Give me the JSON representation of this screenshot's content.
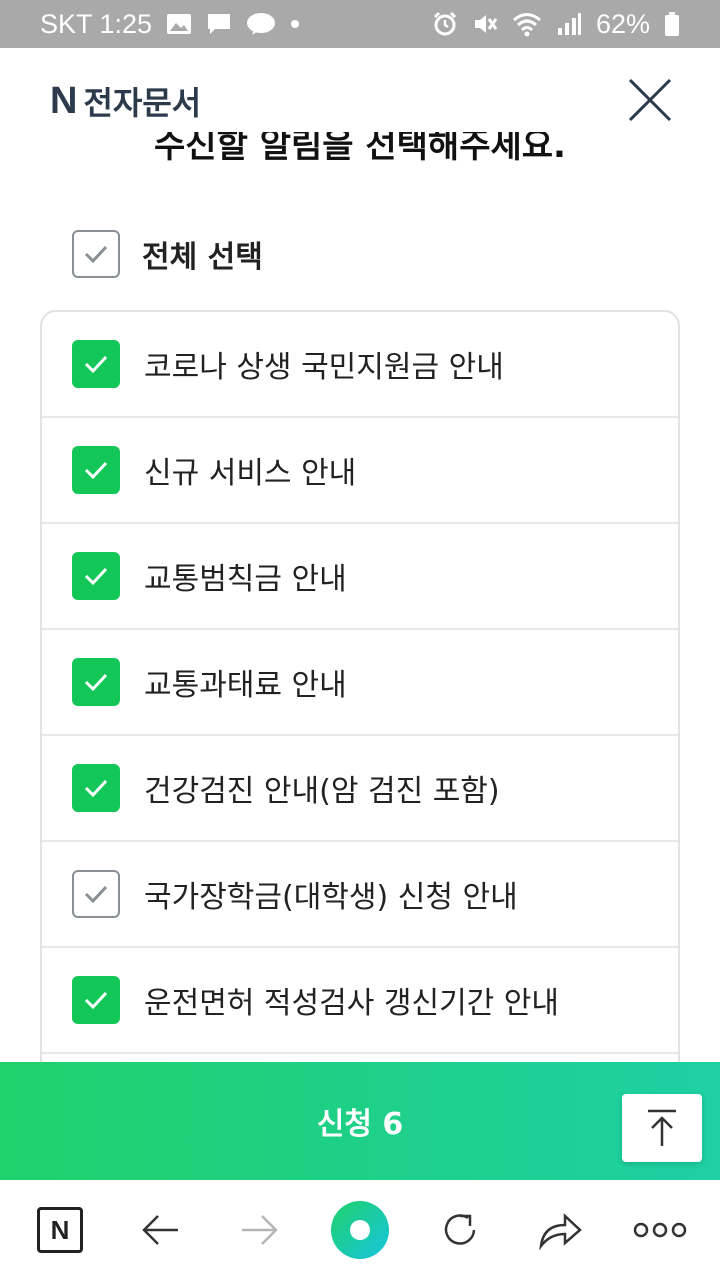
{
  "status_bar": {
    "carrier_time": "SKT 1:25",
    "battery": "62%"
  },
  "header": {
    "brand_logo": "N",
    "brand_title": "전자문서"
  },
  "heading": "수신할 알림을 선택해주세요.",
  "select_all": {
    "label": "전체 선택",
    "checked": false
  },
  "items": [
    {
      "label": "코로나 상생 국민지원금 안내",
      "checked": true
    },
    {
      "label": "신규 서비스 안내",
      "checked": true
    },
    {
      "label": "교통범칙금 안내",
      "checked": true
    },
    {
      "label": "교통과태료 안내",
      "checked": true
    },
    {
      "label": "건강검진 안내(암 검진 포함)",
      "checked": true
    },
    {
      "label": "국가장학금(대학생) 신청 안내",
      "checked": false
    },
    {
      "label": "운전면허 적성검사 갱신기간 안내",
      "checked": true
    }
  ],
  "apply_button": {
    "label": "신청",
    "count": "6"
  },
  "bottom_nav": {
    "home_logo": "N"
  },
  "colors": {
    "accent_green": "#12c657",
    "gradient_end": "#1ed0a4"
  }
}
